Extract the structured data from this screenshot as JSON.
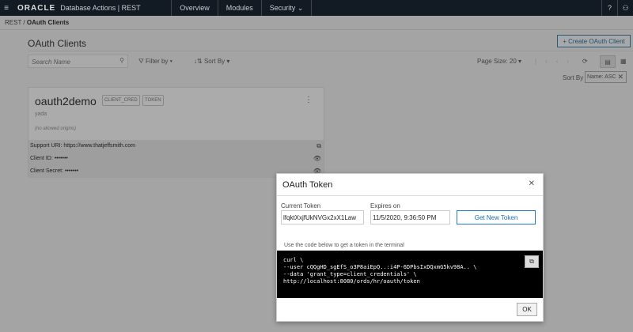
{
  "header": {
    "brand": "ORACLE",
    "app": "Database Actions | REST",
    "nav": [
      "Overview",
      "Modules",
      "Security"
    ]
  },
  "breadcrumb": {
    "root": "REST",
    "current": "OAuth Clients"
  },
  "page": {
    "title": "OAuth Clients",
    "create_label": "Create OAuth Client",
    "search_placeholder": "Search Name",
    "filter_label": "Filter by",
    "sort_label": "Sort By",
    "page_size": "Page Size: 20",
    "sort_by_label": "Sort By",
    "sort_chip": "Name: ASC"
  },
  "card": {
    "name": "oauth2demo",
    "tags": [
      "CLIENT_CRED",
      "TOKEN"
    ],
    "description": "yada",
    "origins": "(no allowed origins)",
    "support_uri": "Support URI: https://www.thatjeffsmith.com",
    "client_id": "Client ID: •••••••",
    "client_secret": "Client Secret: •••••••"
  },
  "modal": {
    "title": "OAuth Token",
    "current_token_label": "Current Token",
    "current_token": "lfqktXxjfUkNVGx2xX1Law",
    "expires_label": "Expires on",
    "expires": "11/5/2020, 9:36:50 PM",
    "get_new_label": "Get New Token",
    "hint": "Use the code below to get a token in the terminal",
    "code": "curl \\\n--user cQQgHD_sgEfS_o3P8aiEpQ..:i4P-6DPbsIxDQxmG5kv98A.. \\\n--data 'grant_type=client_credentials' \\\nhttp://localhost:8080/ords/hr/oauth/token",
    "ok_label": "OK"
  }
}
